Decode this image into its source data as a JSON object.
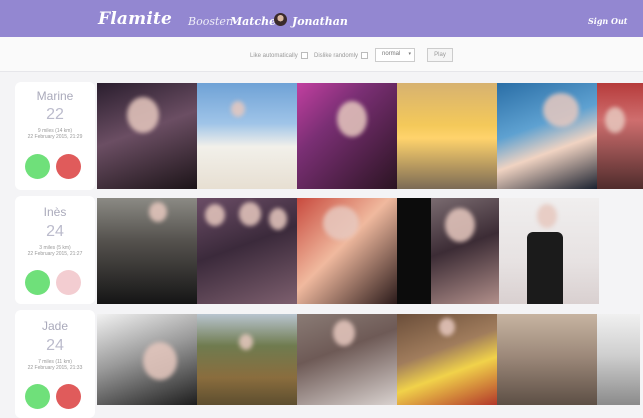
{
  "app": {
    "brand": "Flamite",
    "nav": {
      "booster": "Booster",
      "matches": "Matches",
      "user": "Jonathan"
    },
    "sign_out": "Sign Out"
  },
  "controls": {
    "like_auto": "Like automatically",
    "dislike_random": "Dislike randomly",
    "speed_selected": "normal",
    "play": "Play"
  },
  "profiles": [
    {
      "name": "Marine",
      "age": "22",
      "distance": "9 miles (14 km)",
      "date": "22 February 2015, 21:29",
      "nope_faded": false
    },
    {
      "name": "Inès",
      "age": "24",
      "distance": "3 miles (5 km)",
      "date": "22 February 2015, 21:27",
      "nope_faded": true
    },
    {
      "name": "Jade",
      "age": "24",
      "distance": "7 miles (11 km)",
      "date": "22 February 2015, 21:33",
      "nope_faded": false
    }
  ],
  "colors": {
    "topbar": "#9387d1",
    "like": "#6fe07a",
    "nope": "#e05b5b",
    "nope_faded": "#f3cdd1"
  },
  "icons": {
    "like_button": "green-circle",
    "nope_button": "red-circle",
    "checkbox": "checkbox-empty",
    "dropdown": "chevron-down-icon"
  }
}
